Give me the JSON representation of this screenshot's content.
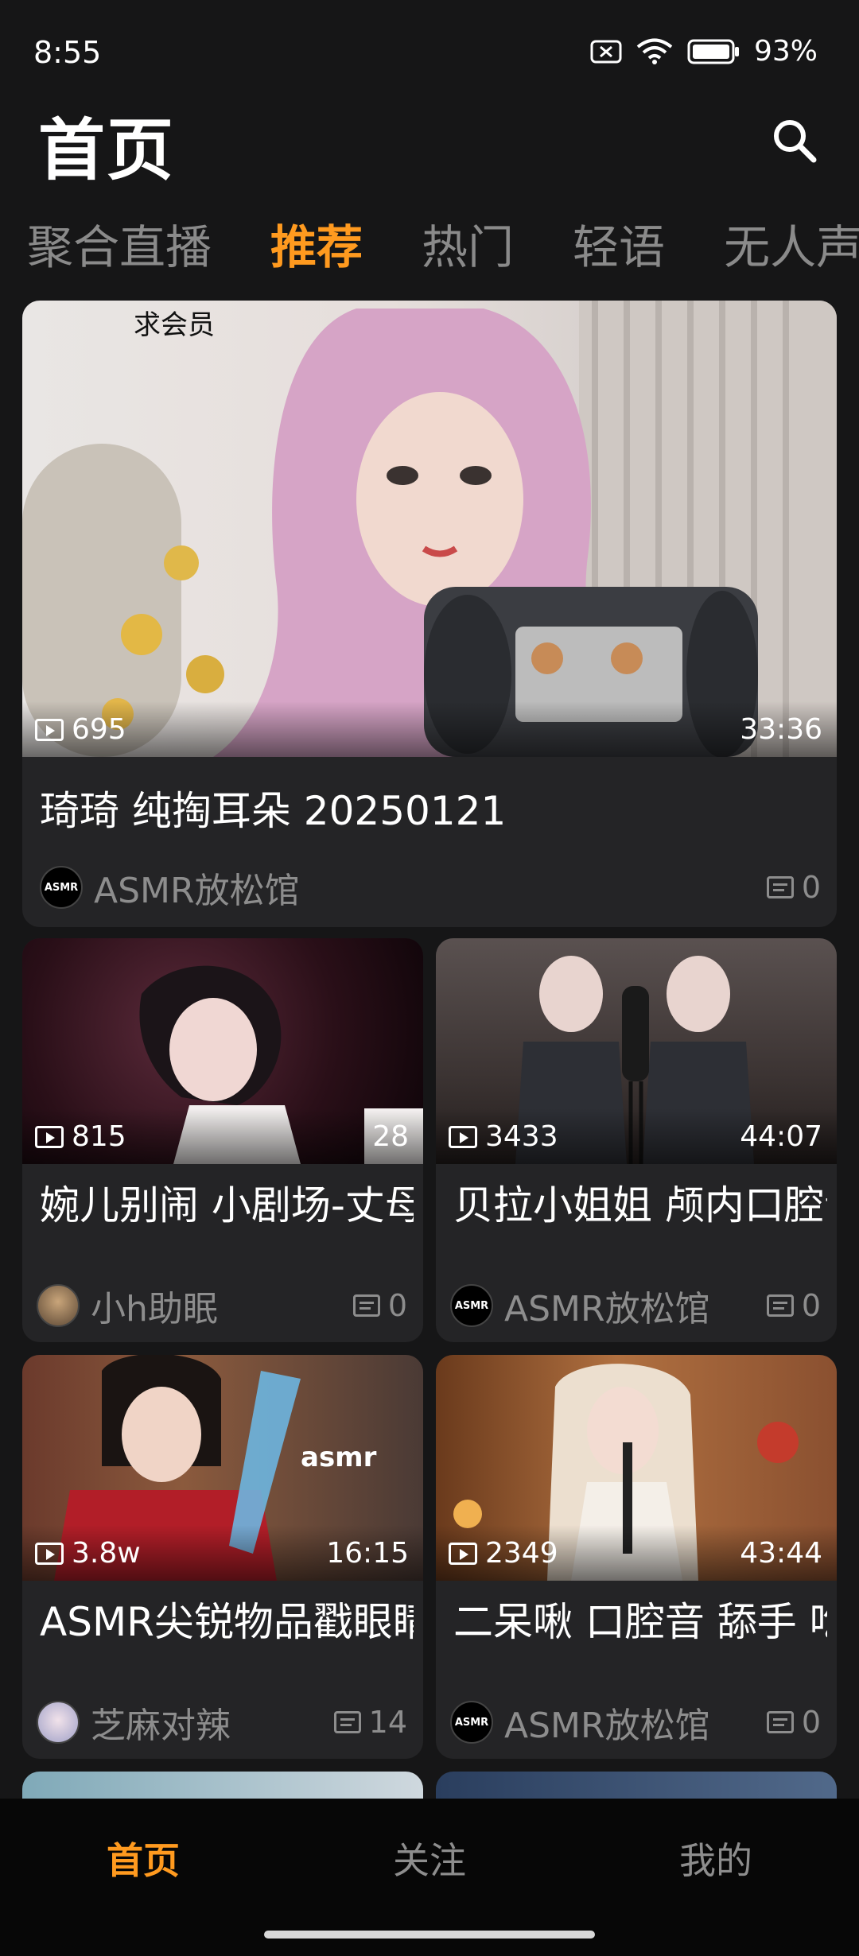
{
  "status": {
    "time": "8:55",
    "battery": "93%"
  },
  "header": {
    "title": "首页"
  },
  "tabs": [
    {
      "label": "聚合直播",
      "active": false
    },
    {
      "label": "推荐",
      "active": true
    },
    {
      "label": "热门",
      "active": false
    },
    {
      "label": "轻语",
      "active": false
    },
    {
      "label": "无人声",
      "active": false
    }
  ],
  "featured": {
    "overlay_text": "求会员",
    "views": "695",
    "duration": "33:36",
    "title": "琦琦 纯掏耳朵 20250121",
    "author": "ASMR放松馆",
    "avatar_text": "ASMR",
    "comments": "0"
  },
  "videos": [
    {
      "views": "815",
      "duration": "28",
      "title": "婉儿别闹 小剧场-丈母娘攻略手册 第",
      "author": "小h助眠",
      "avatar_text": "",
      "comments": "0"
    },
    {
      "views": "3433",
      "duration": "44:07",
      "title": "贝拉小姐姐 颅内口腔音 双倍快乐 苗",
      "author": "ASMR放松馆",
      "avatar_text": "ASMR",
      "comments": "0"
    },
    {
      "views": "3.8w",
      "duration": "16:15",
      "title": "ASMR尖锐物品戳眼睛 视觉刺激 大晾",
      "author": "芝麻对辣",
      "avatar_text": "",
      "comments": "14",
      "thumb_text": "asmr"
    },
    {
      "views": "2349",
      "duration": "43:44",
      "title": "二呆啾 口腔音 舔手 吃耳朵 弹舌 掏耳",
      "author": "ASMR放松馆",
      "avatar_text": "ASMR",
      "comments": "0"
    }
  ],
  "bottom_nav": [
    {
      "label": "首页",
      "active": true
    },
    {
      "label": "关注",
      "active": false
    },
    {
      "label": "我的",
      "active": false
    }
  ],
  "colors": {
    "accent": "#ff9a1f",
    "background": "#161617",
    "card": "#242426",
    "muted": "#8d8d8d"
  }
}
